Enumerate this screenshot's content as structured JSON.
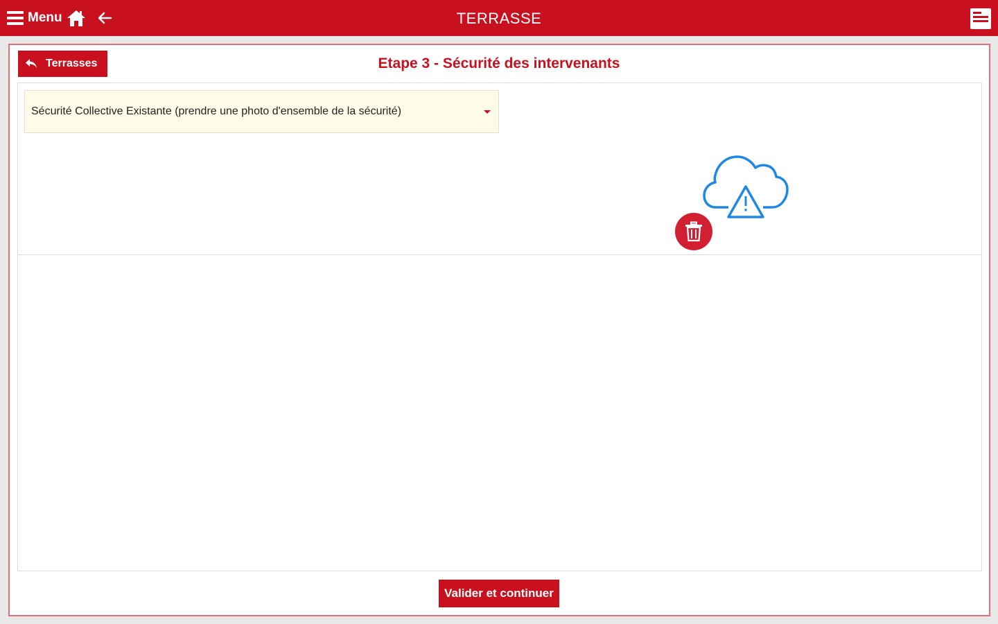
{
  "header": {
    "menu_label": "Menu",
    "title": "TERRASSE",
    "menu_icon": "hamburger-icon",
    "home_icon": "home-icon",
    "back_icon": "arrow-left-icon",
    "logo_icon": "app-logo"
  },
  "back_button": {
    "label": "Terrasses",
    "icon": "reply-arrow-icon"
  },
  "step_title": "Etape 3 - Sécurité des intervenants",
  "form": {
    "select_value": "Sécurité Collective Existante (prendre une photo d'ensemble de la sécurité)"
  },
  "photo": {
    "status_icon": "cloud-warning-icon",
    "delete_icon": "trash-icon"
  },
  "footer": {
    "submit_label": "Valider et continuer"
  },
  "colors": {
    "primary": "#c8101e",
    "accent_blue": "#1e88e5",
    "select_bg": "#fffbe9"
  }
}
